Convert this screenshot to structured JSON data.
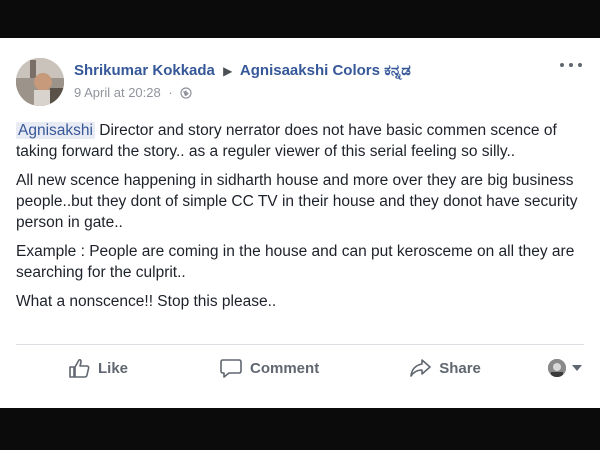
{
  "post": {
    "author": "Shrikumar Kokkada",
    "target": "Agnisaakshi Colors ಕನ್ನಡ",
    "timestamp": "9 April at 20:28",
    "timestamp_sep": "·",
    "privacy_icon": "globe-icon",
    "mention": "Agnisakshi",
    "paragraphs": {
      "p1_rest": " Director and story nerrator does not have basic commen scence of taking forward the story.. as a reguler viewer of this serial feeling so silly..",
      "p2": "All new scence happening in sidharth house and more over they are big business people..but they dont of simple CC TV in their house and they donot have security person in gate..",
      "p3": "Example : People are coming in the house and can put kerosceme on all they are searching for the culprit..",
      "p4": "What a nonscence!! Stop this please.."
    }
  },
  "actions": {
    "like_label": "Like",
    "comment_label": "Comment",
    "share_label": "Share"
  },
  "colors": {
    "link": "#365899",
    "text": "#1d2129",
    "muted": "#90949c",
    "action": "#606770",
    "background_outer": "#0b0b0b"
  }
}
